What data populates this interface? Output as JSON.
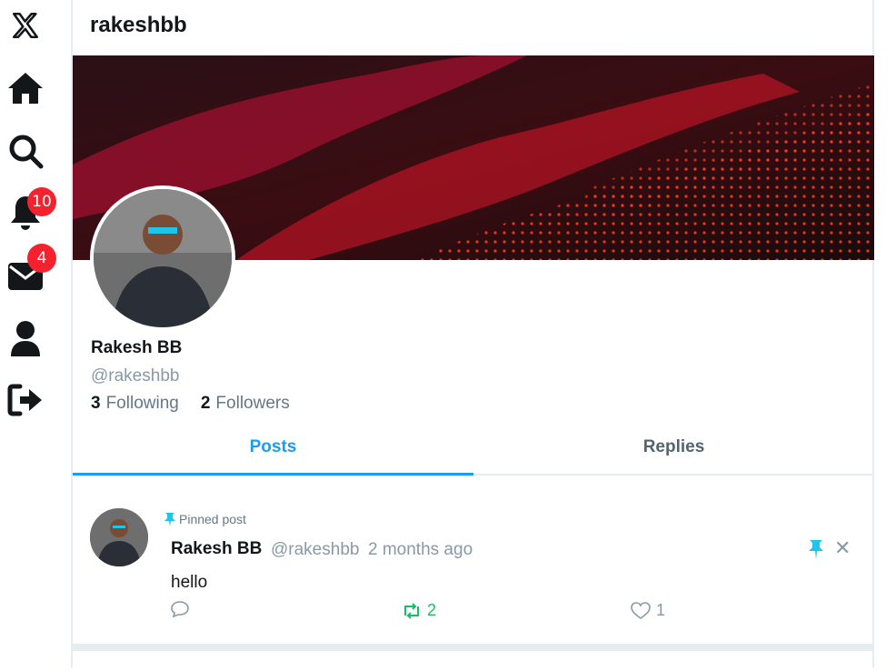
{
  "nav": {
    "notifications_count": "10",
    "messages_count": "4"
  },
  "header": {
    "title": "rakeshbb"
  },
  "profile": {
    "name": "Rakesh BB",
    "handle": "@rakeshbb",
    "following_count": "3",
    "following_label": "Following",
    "followers_count": "2",
    "followers_label": "Followers"
  },
  "tabs": [
    {
      "label": "Posts",
      "active": true
    },
    {
      "label": "Replies",
      "active": false
    }
  ],
  "post": {
    "pinned_label": "Pinned post",
    "author_name": "Rakesh BB",
    "author_handle": "@rakeshbb",
    "time": "2 months ago",
    "text": "hello",
    "retweet_count": "2",
    "like_count": "1"
  },
  "colors": {
    "accent": "#1d9bf0",
    "retweet_green": "#17bf63",
    "badge_red": "#f4212e",
    "pin_cyan": "#1cc6e8"
  }
}
